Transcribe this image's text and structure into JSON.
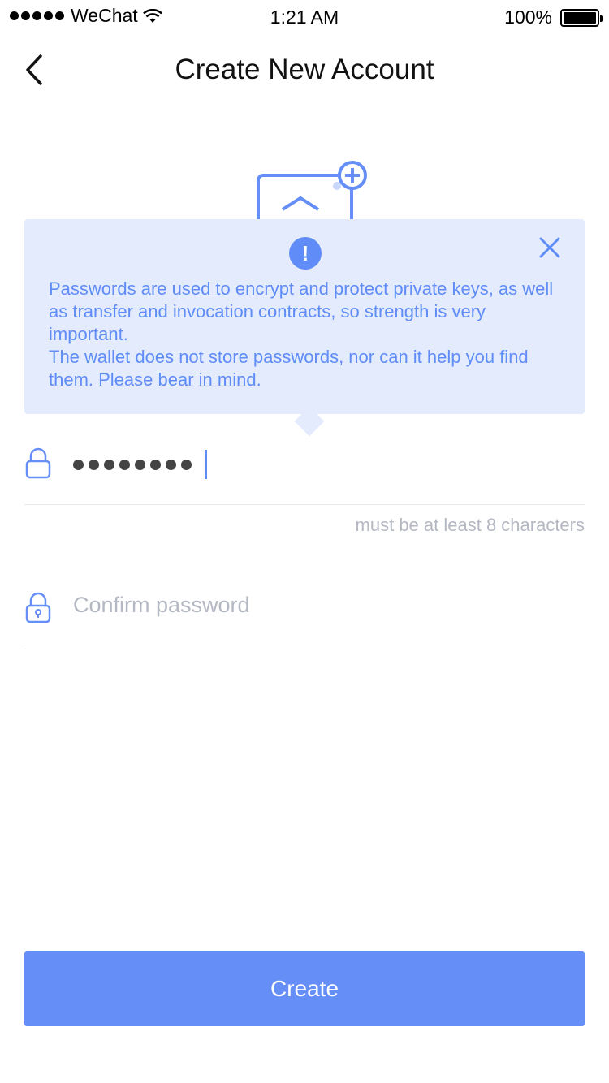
{
  "status_bar": {
    "carrier": "WeChat",
    "time": "1:21 AM",
    "battery": "100%"
  },
  "nav": {
    "title": "Create New Account",
    "back_icon": "chevron-left-icon"
  },
  "tooltip": {
    "info_icon": "!",
    "close_icon": "close-icon",
    "line1": "Passwords are used to encrypt and protect private keys, as well as transfer and invocation contracts, so strength is very important.",
    "line2": "The wallet does not store passwords, nor can it help you find them. Please bear in mind."
  },
  "password_field": {
    "masked_value": "••••••••",
    "hint": "must be at least 8 characters",
    "icon": "lock-icon"
  },
  "confirm_field": {
    "placeholder": "Confirm password",
    "icon": "lock-keyhole-icon"
  },
  "create_button": {
    "label": "Create"
  },
  "colors": {
    "accent": "#658ff7",
    "tooltip_bg": "#e3ebfd",
    "tooltip_text": "#5f8cf6",
    "placeholder": "#b4b8c2"
  }
}
